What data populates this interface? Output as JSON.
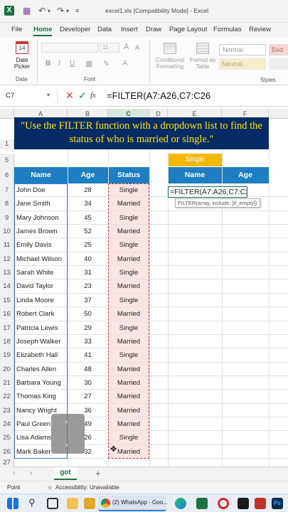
{
  "titlebar": {
    "title": "excel1.xls [Compatibility Mode] - Excel",
    "app_icon": "X"
  },
  "menu": [
    "File",
    "Home",
    "Developer",
    "Data",
    "Insert",
    "Draw",
    "Page Layout",
    "Formulas",
    "Review"
  ],
  "ribbon": {
    "date_picker": "Date\nPicker",
    "date_icon_num": "14",
    "date_group": "Date",
    "font_group": "Font",
    "font_size": "11",
    "conditional": "Conditional\nFormatting",
    "format_as": "Format as\nTable",
    "style_normal": "Normal",
    "style_bad": "Bad",
    "style_neutral": "Neutral",
    "styles_group": "Styles",
    "bold": "B",
    "italic": "I",
    "underline": "U",
    "grow": "A",
    "shrink": "A"
  },
  "formulabar": {
    "namebox": "C7",
    "formula": "=FILTER(A7:A26,C7:C26"
  },
  "columns": [
    "A",
    "B",
    "C",
    "D",
    "E",
    "F"
  ],
  "rows_visible": [
    "1",
    "2",
    "3",
    "4",
    "5",
    "6",
    "7",
    "8",
    "9",
    "10",
    "11",
    "12",
    "13",
    "14",
    "15",
    "16",
    "17",
    "18",
    "19",
    "20",
    "21",
    "22",
    "23",
    "24",
    "25",
    "26",
    "27"
  ],
  "banner_text": "\"Use the FILTER function with a dropdown list to find the status of who is married or single.\"",
  "table": {
    "headers": [
      "Name",
      "Age",
      "Status"
    ],
    "rows": [
      [
        "John Doe",
        "28",
        "Single"
      ],
      [
        "Jane Smith",
        "34",
        "Married"
      ],
      [
        "Mary Johnson",
        "45",
        "Single"
      ],
      [
        "James Brown",
        "52",
        "Married"
      ],
      [
        "Emily Davis",
        "25",
        "Single"
      ],
      [
        "Michael Wilson",
        "40",
        "Married"
      ],
      [
        "Sarah White",
        "31",
        "Single"
      ],
      [
        "David Taylor",
        "23",
        "Married"
      ],
      [
        "Linda Moore",
        "37",
        "Single"
      ],
      [
        "Robert Clark",
        "50",
        "Married"
      ],
      [
        "Patricia Lewis",
        "29",
        "Single"
      ],
      [
        "Joseph Walker",
        "33",
        "Married"
      ],
      [
        "Elizabeth Hall",
        "41",
        "Single"
      ],
      [
        "Charles Allen",
        "48",
        "Married"
      ],
      [
        "Barbara Young",
        "30",
        "Married"
      ],
      [
        "Thomas King",
        "27",
        "Married"
      ],
      [
        "Nancy Wright",
        "36",
        "Married"
      ],
      [
        "Paul Green",
        "49",
        "Married"
      ],
      [
        "Lisa Adams",
        "26",
        "Single"
      ],
      [
        "Mark Baker",
        "32",
        "Married"
      ]
    ]
  },
  "dropdown_value": "Single",
  "result_headers": [
    "Name",
    "Age"
  ],
  "editing_formula": "=FILTER(A7:A26,C7:C26",
  "formula_tooltip": "FILTER(array, include, [if_empty])",
  "sheet_tab": "got",
  "status": {
    "mode": "Point",
    "accessibility": "Accessibility: Unavailable"
  },
  "taskbar": {
    "whatsapp": "(2) WhatsApp - Goo..."
  },
  "colors": {
    "header_blue": "#1f7ec1",
    "banner_bg": "#062b65",
    "banner_text": "#ffe400",
    "dropdown": "#f5b800",
    "excel_green": "#1e7145",
    "status_fill": "#fbe4e4"
  }
}
